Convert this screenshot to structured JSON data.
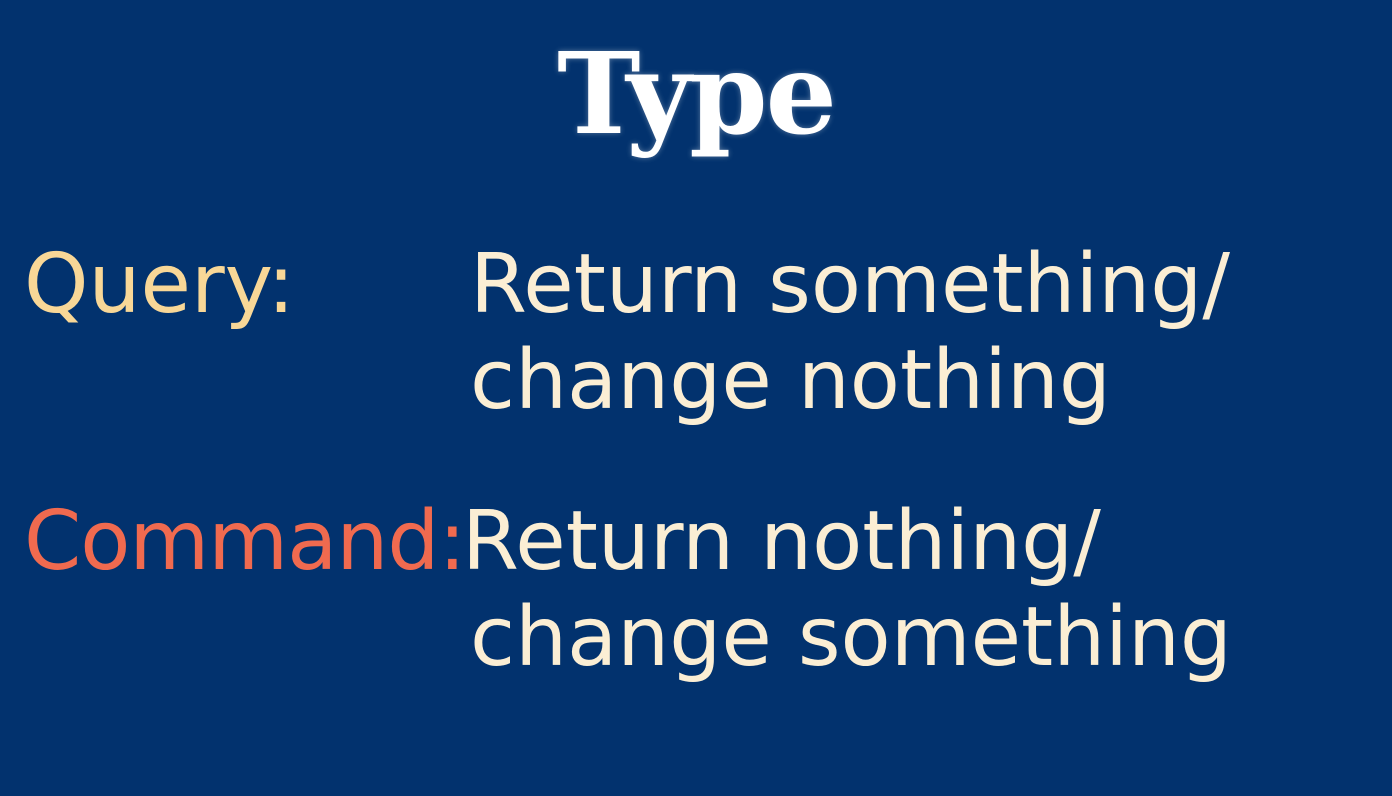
{
  "slide": {
    "title": "Type",
    "rows": [
      {
        "label": "Query:",
        "line1": "Return something/",
        "line2": "change nothing"
      },
      {
        "label": "Command:",
        "line1": "Return nothing/",
        "line2": "change something"
      }
    ]
  },
  "colors": {
    "background": "#02326e",
    "title": "#ffffff",
    "query_label": "#f8d797",
    "command_label": "#f06a4f",
    "body_text": "#fbeed4"
  }
}
